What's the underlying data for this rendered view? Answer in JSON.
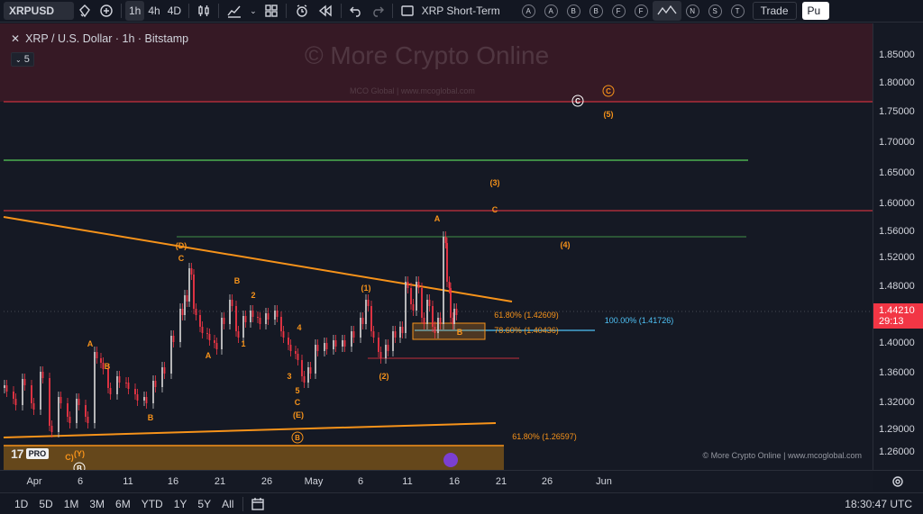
{
  "toolbar": {
    "symbol": "XRPUSD",
    "intervals": [
      "1h",
      "4h",
      "4D"
    ],
    "active_interval": "1h",
    "layout_name": "XRP Short-Term",
    "alert_letters": [
      "A",
      "A",
      "B",
      "B",
      "F",
      "F"
    ],
    "right_letters": [
      "N",
      "S",
      "T"
    ],
    "trade_label": "Trade",
    "publish_label": "Pu"
  },
  "legend": {
    "title": "XRP / U.S. Dollar · 1h · Bitstamp",
    "indicator_count": "5"
  },
  "watermark": {
    "main": "© More Crypto Online",
    "sub": "MCO Global   |   www.mcoglobal.com"
  },
  "footer_credit": "© More Crypto Online   |   www.mcoglobal.com",
  "tv_logo": {
    "mark": "17",
    "badge": "PRO"
  },
  "price_axis": {
    "labels": [
      "1.85000",
      "1.80000",
      "1.75000",
      "1.70000",
      "1.65000",
      "1.60000",
      "1.56000",
      "1.52000",
      "1.48000",
      "1.44000",
      "1.40000",
      "1.36000",
      "1.32000",
      "1.29000",
      "1.26000"
    ],
    "current_price": "1.44210",
    "countdown": "29:13"
  },
  "time_axis": {
    "labels": [
      "Apr",
      "6",
      "11",
      "16",
      "21",
      "26",
      "May",
      "6",
      "11",
      "16",
      "21",
      "26",
      "Jun"
    ]
  },
  "bottombar": {
    "ranges": [
      "1D",
      "5D",
      "1M",
      "3M",
      "6M",
      "YTD",
      "1Y",
      "5Y",
      "All"
    ],
    "clock": "18:30:47 UTC"
  },
  "annotations": {
    "fib_618_upper": "61.80% (1.42609)",
    "fib_786": "78.60% (1.40436)",
    "fib_100": "100.00% (1.41726)",
    "fib_618_lower": "61.80% (1.26597)",
    "waves": [
      "(D)",
      "C",
      "B",
      "2",
      "1",
      "A",
      "4",
      "3",
      "5",
      "C",
      "(E)",
      "B",
      "A",
      "B",
      "(1)",
      "(2)",
      "A",
      "C",
      "(3)",
      "(4)",
      "(5)",
      "B",
      "(Y)",
      "C)"
    ],
    "circled": [
      "C",
      "C",
      "B",
      "B"
    ]
  },
  "colors": {
    "background": "#151924",
    "red_zone": "#3a1a26",
    "orange": "#f7931a",
    "green": "#4caf50",
    "red_line": "#f23645",
    "cyan": "#4fc3f7",
    "candle_up": "#c8c8c8",
    "candle_down": "#f23645"
  }
}
